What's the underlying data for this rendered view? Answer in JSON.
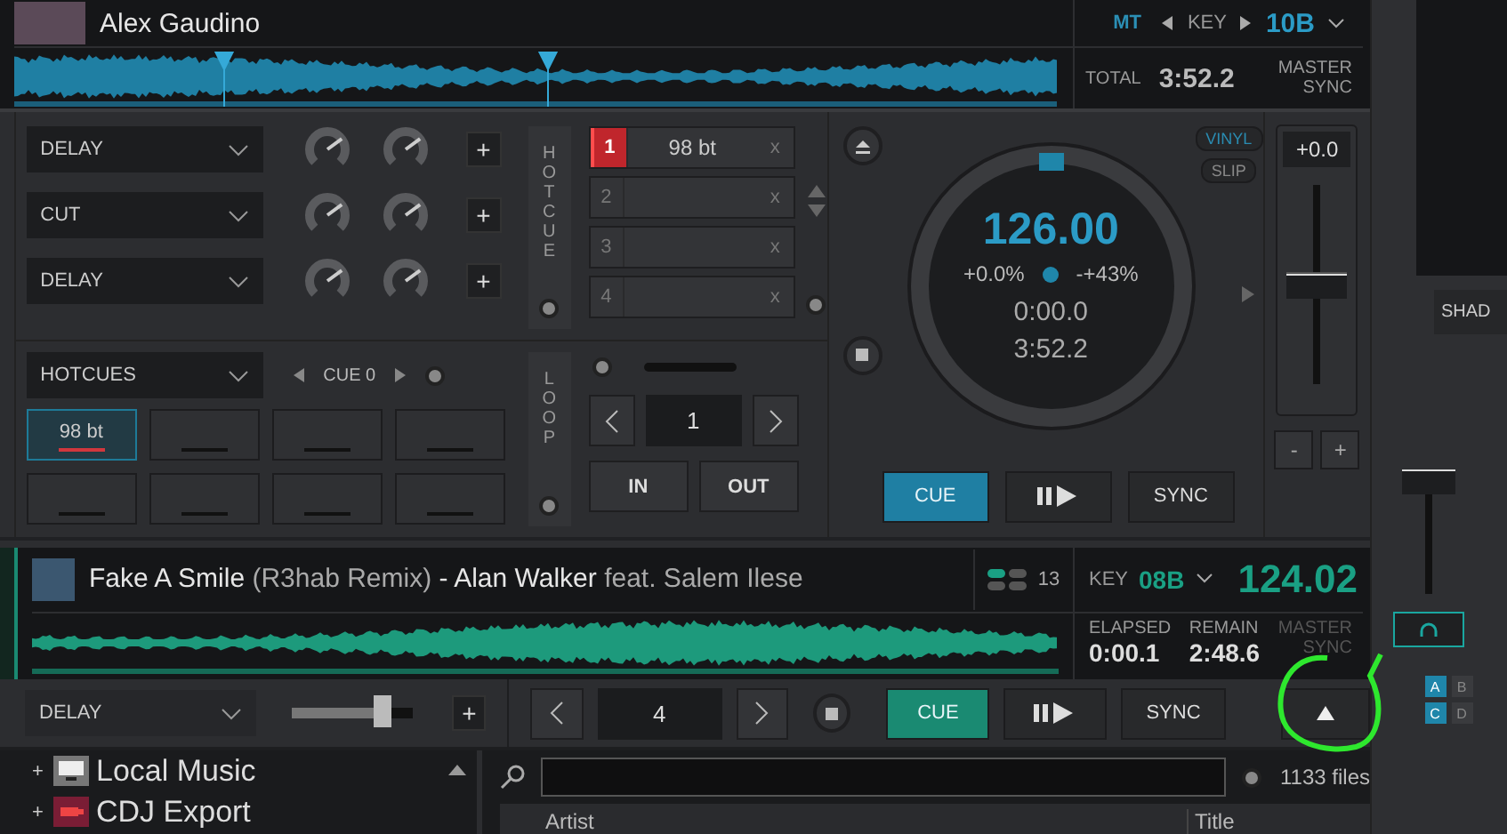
{
  "deck_a": {
    "artist": "Alex Gaudino",
    "mt": "MT",
    "key_label": "KEY",
    "key": "10B",
    "total_label": "TOTAL",
    "total": "3:52.2",
    "master": "MASTER",
    "sync": "SYNC"
  },
  "fx": [
    {
      "effect": "DELAY",
      "plus": "+"
    },
    {
      "effect": "CUT",
      "plus": "+"
    },
    {
      "effect": "DELAY",
      "plus": "+"
    }
  ],
  "hotcue_label": "HOTCUE",
  "cues": [
    {
      "number": "1",
      "label": "98 bt",
      "set": true,
      "remove": "x"
    },
    {
      "number": "2",
      "set": false,
      "remove": "x"
    },
    {
      "number": "3",
      "set": false,
      "remove": "x"
    },
    {
      "number": "4",
      "set": false,
      "remove": "x"
    }
  ],
  "pads": {
    "mode": "HOTCUES",
    "page": "CUE 0",
    "cells": [
      {
        "label": "98 bt",
        "set": true
      },
      {
        "set": false
      },
      {
        "set": false
      },
      {
        "set": false
      },
      {
        "set": false
      },
      {
        "set": false
      },
      {
        "set": false
      },
      {
        "set": false
      }
    ]
  },
  "loop": {
    "label": "LOOP",
    "value": "1",
    "in": "IN",
    "out": "OUT"
  },
  "jog": {
    "bpm": "126.00",
    "pitch": "+0.0%",
    "range": "-+43%",
    "elapsed": "0:00.0",
    "remaining": "3:52.2",
    "vinyl": {
      "label": "VINYL",
      "on": true
    },
    "slip": {
      "label": "SLIP",
      "on": false
    }
  },
  "pitch": {
    "reading": "+0.0",
    "level": 0.5,
    "minus": "-",
    "plus": "+"
  },
  "transport_a": {
    "cue": "CUE",
    "sync": "SYNC"
  },
  "deck_b": {
    "title": "Fake A Smile",
    "mix": "(R3hab Remix)",
    "dash": "-",
    "artist": "Alan Walker",
    "feat": "feat. Salem Ilese",
    "count": "13",
    "key_label": "KEY",
    "key": "08B",
    "bpm": "124.02",
    "elapsed_label": "ELAPSED",
    "elapsed": "0:00.1",
    "remain_label": "REMAIN",
    "remain": "2:48.6",
    "master": "MASTER",
    "sync": "SYNC"
  },
  "controls_b": {
    "effect": "DELAY",
    "level": 0.75,
    "plus": "+",
    "loop_value": "4",
    "cue": "CUE",
    "sync": "SYNC"
  },
  "mixer": {
    "shader": "SHAD",
    "decks": [
      {
        "label": "A",
        "selected": true
      },
      {
        "label": "B",
        "selected": false
      },
      {
        "label": "C",
        "selected": true
      },
      {
        "label": "D",
        "selected": false
      }
    ]
  },
  "browser": {
    "tree": [
      {
        "toggle": "+",
        "label": "Local Music",
        "kind": "computer"
      },
      {
        "toggle": "+",
        "label": "CDJ Export",
        "kind": "usb"
      }
    ],
    "file_count": "1133 files",
    "columns": [
      "Artist",
      "Title"
    ]
  }
}
